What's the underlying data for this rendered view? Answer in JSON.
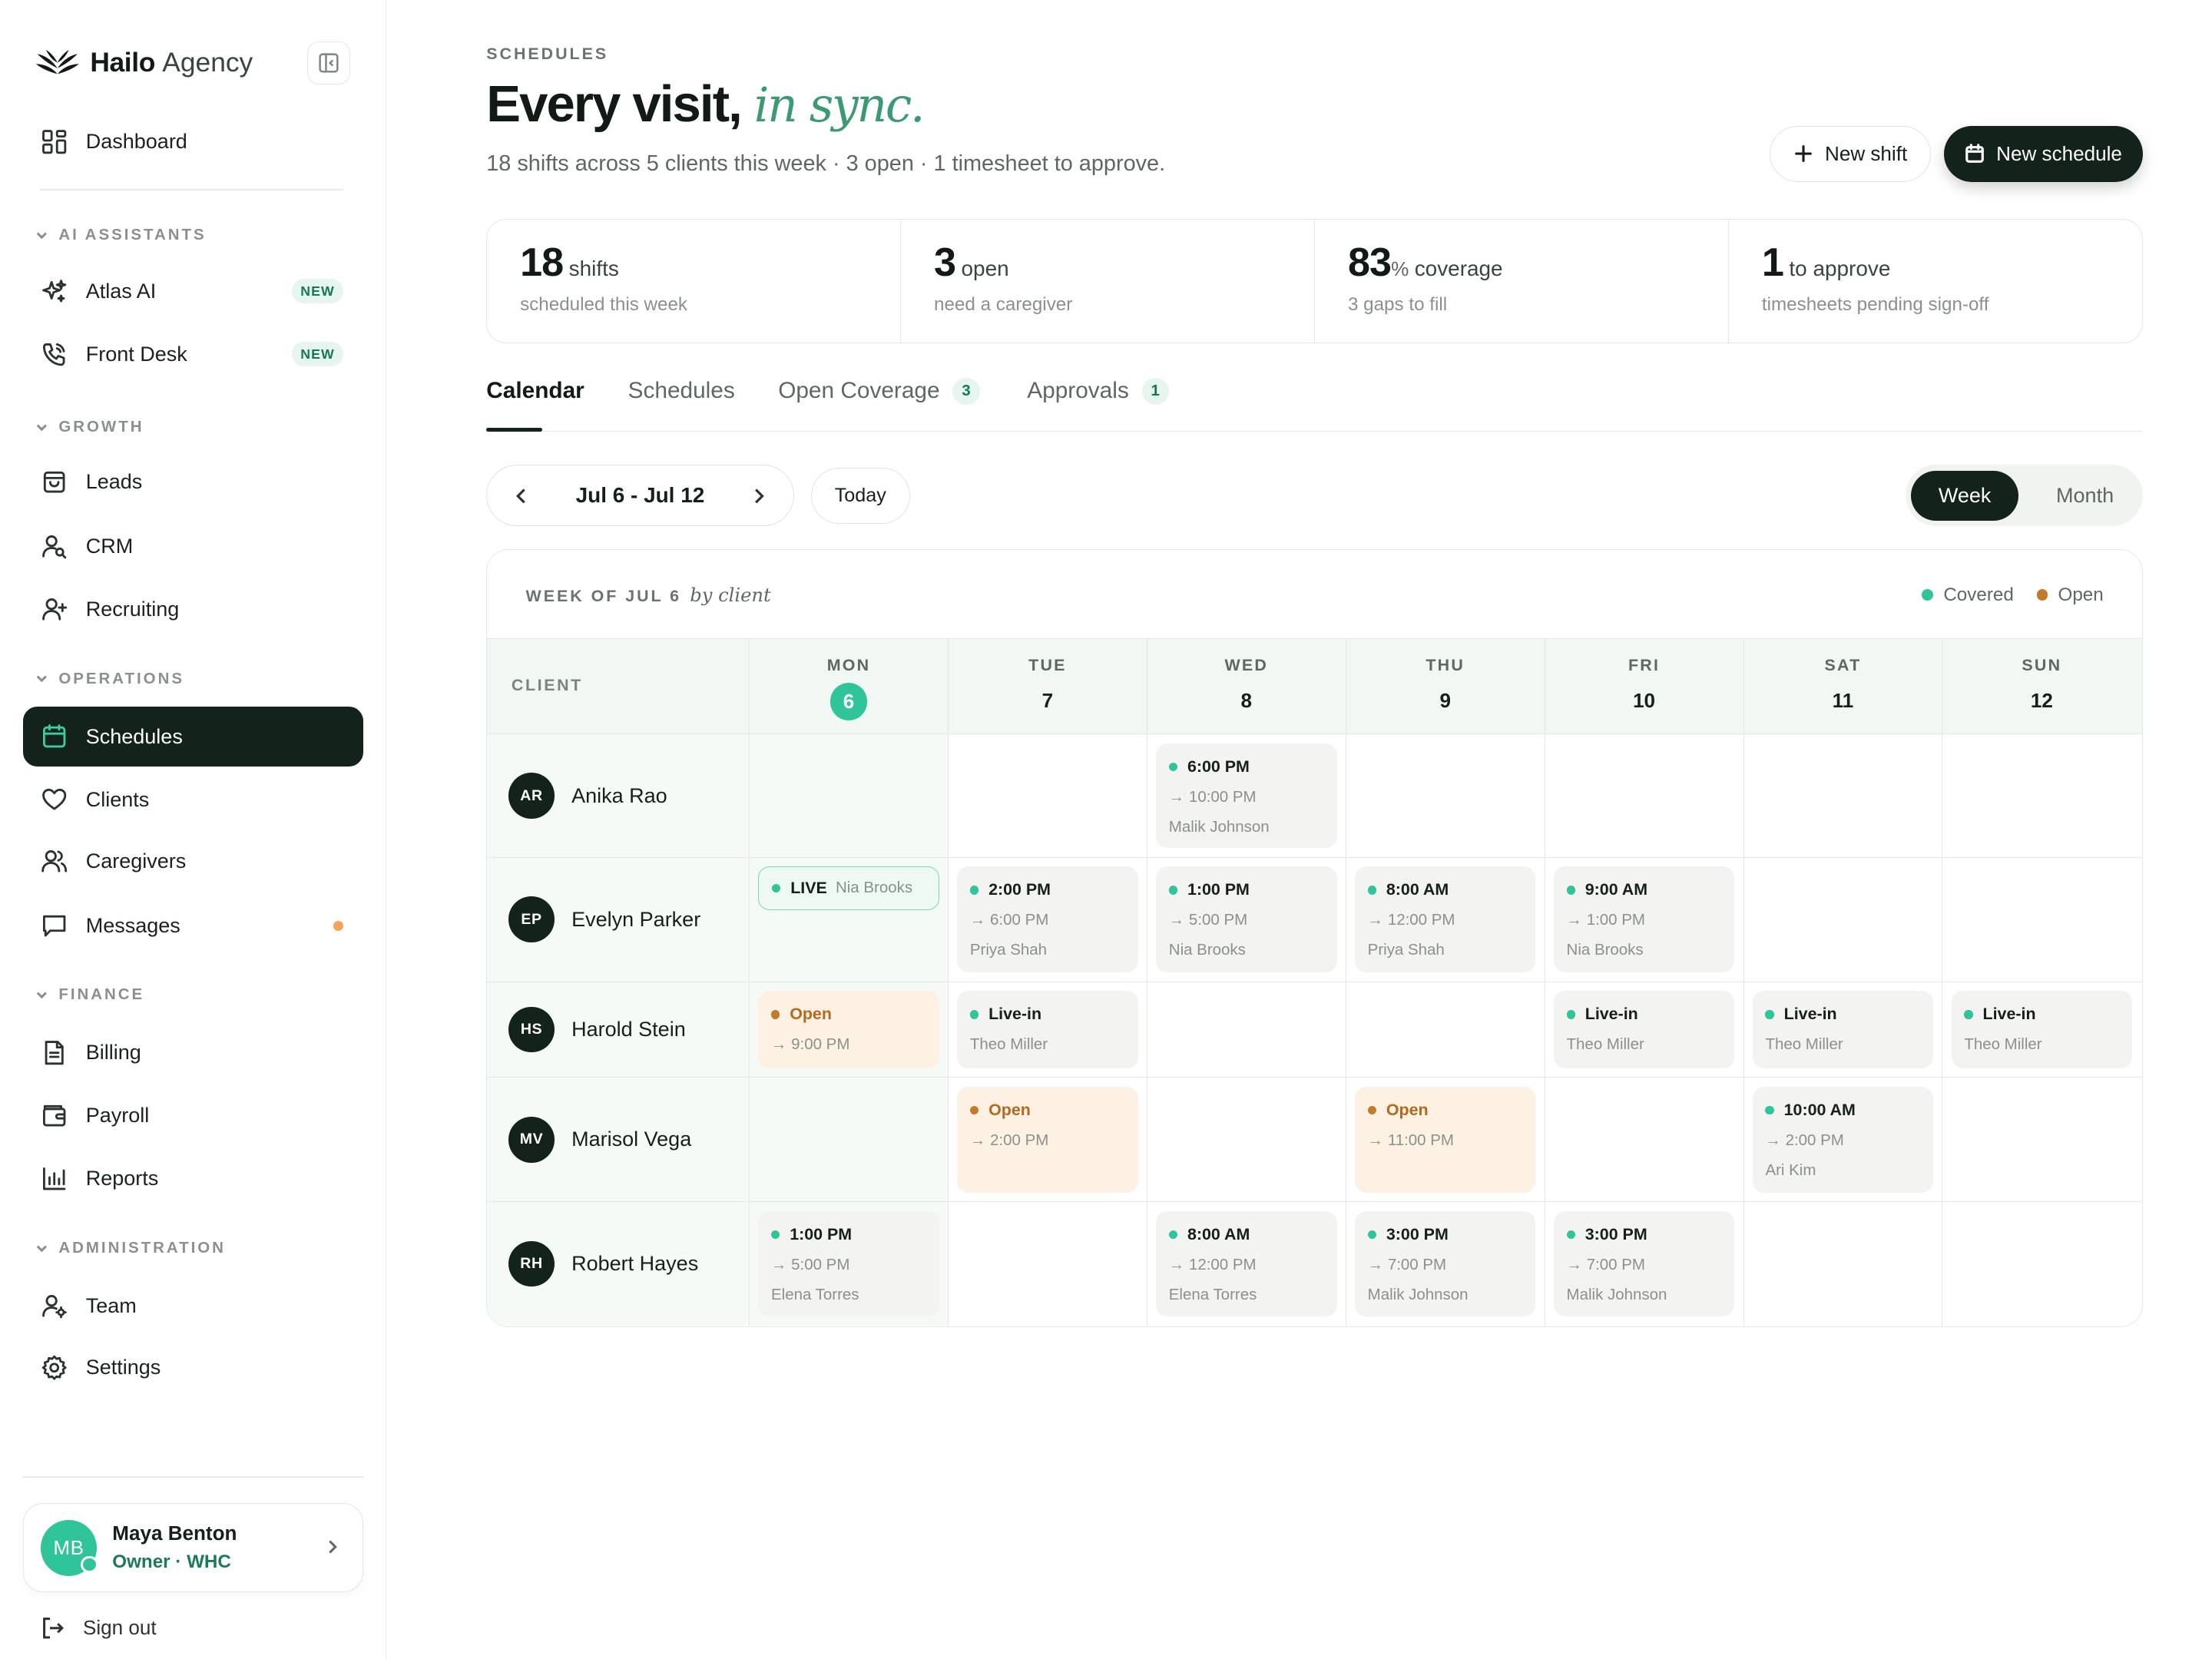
{
  "brand": {
    "name": "Hailo",
    "suffix": "Agency"
  },
  "nav": {
    "dashboard": "Dashboard",
    "sections": {
      "ai": "AI ASSISTANTS",
      "growth": "GROWTH",
      "operations": "OPERATIONS",
      "finance": "FINANCE",
      "administration": "ADMINISTRATION"
    },
    "atlas": "Atlas AI",
    "front_desk": "Front Desk",
    "new_badge": "NEW",
    "leads": "Leads",
    "crm": "CRM",
    "recruiting": "Recruiting",
    "schedules": "Schedules",
    "clients": "Clients",
    "caregivers": "Caregivers",
    "messages": "Messages",
    "billing": "Billing",
    "payroll": "Payroll",
    "reports": "Reports",
    "team": "Team",
    "settings": "Settings"
  },
  "user": {
    "initials": "MB",
    "name": "Maya Benton",
    "role": "Owner · WHC"
  },
  "signout": "Sign out",
  "header": {
    "eyebrow": "SCHEDULES",
    "title_main": "Every visit,",
    "title_accent": "in sync.",
    "subtitle": "18 shifts across 5 clients this week · 3 open · 1 timesheet to approve.",
    "new_shift": "New shift",
    "new_schedule": "New schedule"
  },
  "stats": [
    {
      "value": "18",
      "pct": "",
      "unit": "shifts",
      "desc": "scheduled this week"
    },
    {
      "value": "3",
      "pct": "",
      "unit": "open",
      "desc": "need a caregiver"
    },
    {
      "value": "83",
      "pct": "%",
      "unit": "coverage",
      "desc": "3 gaps to fill"
    },
    {
      "value": "1",
      "pct": "",
      "unit": "to approve",
      "desc": "timesheets pending sign-off"
    }
  ],
  "tabs": {
    "calendar": "Calendar",
    "schedules": "Schedules",
    "open_coverage": "Open Coverage",
    "open_coverage_count": "3",
    "approvals": "Approvals",
    "approvals_count": "1"
  },
  "controls": {
    "range": "Jul 6 - Jul 12",
    "today": "Today",
    "week": "Week",
    "month": "Month"
  },
  "calendar": {
    "week_label": "WEEK OF JUL 6",
    "by_client": "by client",
    "legend_covered": "Covered",
    "legend_open": "Open",
    "client_header": "CLIENT",
    "colors": {
      "covered": "#2fc49a",
      "open": "#c27a2c"
    },
    "days": [
      {
        "name": "MON",
        "date": "6",
        "today": true
      },
      {
        "name": "TUE",
        "date": "7"
      },
      {
        "name": "WED",
        "date": "8"
      },
      {
        "name": "THU",
        "date": "9"
      },
      {
        "name": "FRI",
        "date": "10"
      },
      {
        "name": "SAT",
        "date": "11"
      },
      {
        "name": "SUN",
        "date": "12"
      }
    ],
    "rows": [
      {
        "initials": "AR",
        "name": "Anika Rao",
        "shifts": [
          {
            "day": 2,
            "kind": "covered",
            "start": "6:00 PM",
            "end": "→ 10:00 PM",
            "who": "Malik Johnson"
          }
        ]
      },
      {
        "initials": "EP",
        "name": "Evelyn Parker",
        "shifts": [
          {
            "day": 0,
            "kind": "live",
            "start": "LIVE",
            "who": "Nia Brooks"
          },
          {
            "day": 1,
            "kind": "covered",
            "start": "2:00 PM",
            "end": "→ 6:00 PM",
            "who": "Priya Shah"
          },
          {
            "day": 2,
            "kind": "covered",
            "start": "1:00 PM",
            "end": "→ 5:00 PM",
            "who": "Nia Brooks"
          },
          {
            "day": 3,
            "kind": "covered",
            "start": "8:00 AM",
            "end": "→ 12:00 PM",
            "who": "Priya Shah"
          },
          {
            "day": 4,
            "kind": "covered",
            "start": "9:00 AM",
            "end": "→ 1:00 PM",
            "who": "Nia Brooks"
          }
        ]
      },
      {
        "initials": "HS",
        "name": "Harold Stein",
        "shifts": [
          {
            "day": 0,
            "kind": "open",
            "start": "Open",
            "end": "→ 9:00 PM"
          },
          {
            "day": 1,
            "kind": "covered",
            "start": "Live-in",
            "end": "Theo Miller"
          },
          {
            "day": 4,
            "kind": "covered",
            "start": "Live-in",
            "end": "Theo Miller"
          },
          {
            "day": 5,
            "kind": "covered",
            "start": "Live-in",
            "end": "Theo Miller"
          },
          {
            "day": 6,
            "kind": "covered",
            "start": "Live-in",
            "end": "Theo Miller"
          }
        ]
      },
      {
        "initials": "MV",
        "name": "Marisol Vega",
        "shifts": [
          {
            "day": 1,
            "kind": "open",
            "start": "Open",
            "end": "→ 2:00 PM"
          },
          {
            "day": 3,
            "kind": "open",
            "start": "Open",
            "end": "→ 11:00 PM"
          },
          {
            "day": 5,
            "kind": "covered",
            "start": "10:00 AM",
            "end": "→ 2:00 PM",
            "who": "Ari Kim"
          }
        ]
      },
      {
        "initials": "RH",
        "name": "Robert Hayes",
        "shifts": [
          {
            "day": 0,
            "kind": "covered",
            "start": "1:00 PM",
            "end": "→ 5:00 PM",
            "who": "Elena Torres"
          },
          {
            "day": 2,
            "kind": "covered",
            "start": "8:00 AM",
            "end": "→ 12:00 PM",
            "who": "Elena Torres"
          },
          {
            "day": 3,
            "kind": "covered",
            "start": "3:00 PM",
            "end": "→ 7:00 PM",
            "who": "Malik Johnson"
          },
          {
            "day": 4,
            "kind": "covered",
            "start": "3:00 PM",
            "end": "→ 7:00 PM",
            "who": "Malik Johnson"
          }
        ]
      }
    ]
  }
}
